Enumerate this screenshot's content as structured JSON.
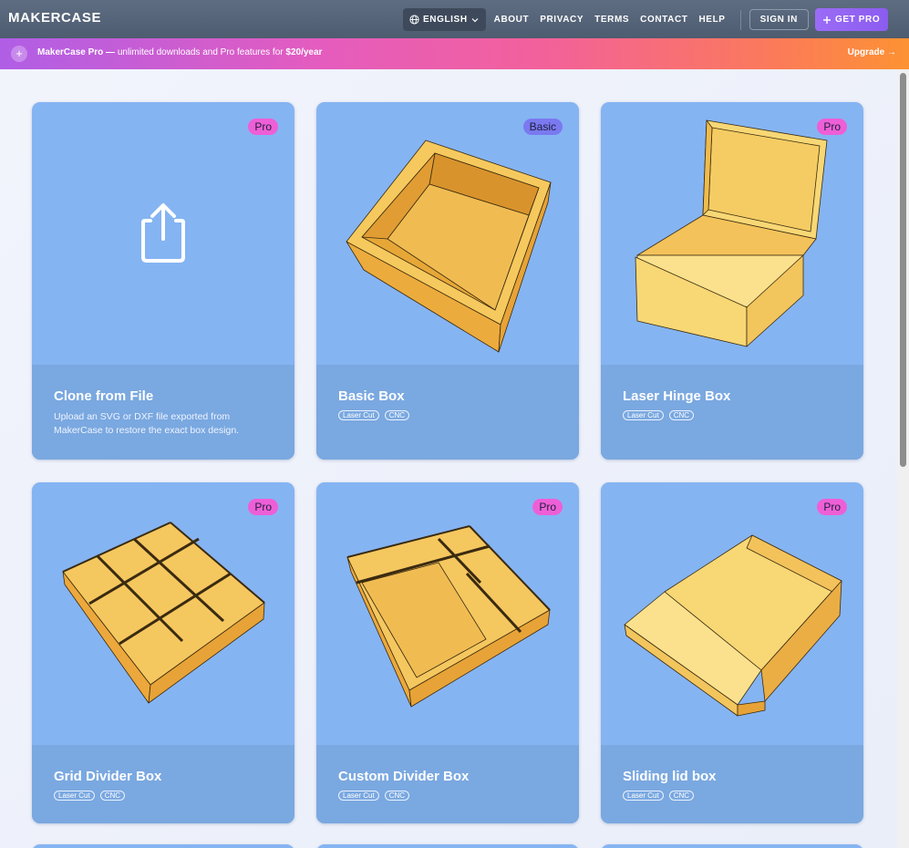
{
  "header": {
    "logo": "MAKERCASE",
    "language": "ENGLISH",
    "nav": [
      "ABOUT",
      "PRIVACY",
      "TERMS",
      "CONTACT",
      "HELP"
    ],
    "sign_in": "SIGN IN",
    "get_pro": "GET PRO"
  },
  "promo": {
    "brand": "MakerCase Pro —",
    "text": " unlimited downloads and Pro features for ",
    "price": "$20/year",
    "upgrade": "Upgrade →"
  },
  "cards": [
    {
      "title": "Clone from File",
      "badge": "Pro",
      "description": "Upload an SVG or DXF file exported from MakerCase to restore the exact box design.",
      "tags": []
    },
    {
      "title": "Basic Box",
      "badge": "Basic",
      "description": "",
      "tags": [
        "Laser Cut",
        "CNC"
      ]
    },
    {
      "title": "Laser Hinge Box",
      "badge": "Pro",
      "description": "",
      "tags": [
        "Laser Cut",
        "CNC"
      ]
    },
    {
      "title": "Grid Divider Box",
      "badge": "Pro",
      "description": "",
      "tags": [
        "Laser Cut",
        "CNC"
      ]
    },
    {
      "title": "Custom Divider Box",
      "badge": "Pro",
      "description": "",
      "tags": [
        "Laser Cut",
        "CNC"
      ]
    },
    {
      "title": "Sliding lid box",
      "badge": "Pro",
      "description": "",
      "tags": [
        "Laser Cut",
        "CNC"
      ]
    }
  ],
  "colors": {
    "card_bg": "#85b4f2",
    "card_info_bg": "#7aa8e0",
    "pro_badge": "#ee5fd7",
    "basic_badge": "#7a79f0",
    "wood": "#f3c25a"
  }
}
